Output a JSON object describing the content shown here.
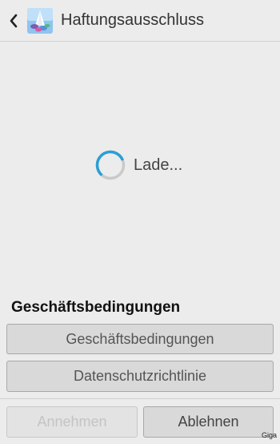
{
  "header": {
    "title": "Haftungsausschluss",
    "back_icon": "chevron-left-icon",
    "app_icon": "app-logo-icon"
  },
  "loading": {
    "text": "Lade...",
    "spinner_color": "#2a9fd6"
  },
  "terms_section": {
    "heading": "Geschäftsbedingungen",
    "terms_button": "Geschäftsbedingungen",
    "privacy_button": "Datenschutzrichtlinie"
  },
  "footer": {
    "accept_label": "Annehmen",
    "accept_enabled": false,
    "decline_label": "Ablehnen"
  },
  "watermark": "Giga"
}
